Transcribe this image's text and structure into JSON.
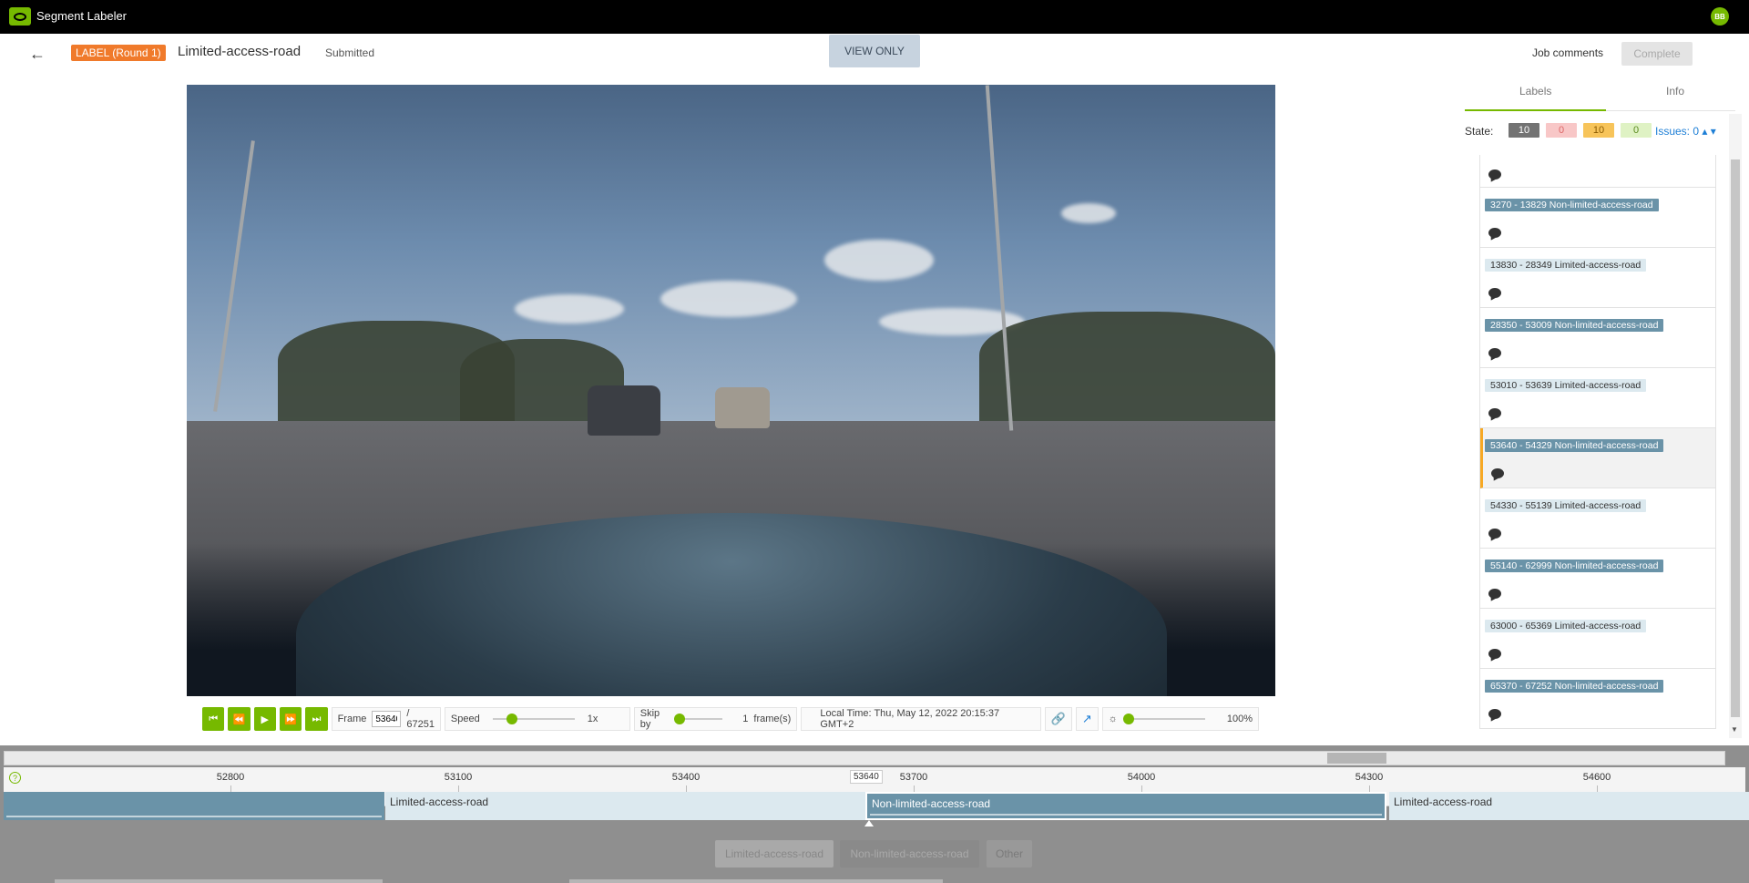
{
  "app": {
    "title": "Segment Labeler",
    "user_initials": "BB"
  },
  "header": {
    "badge": "LABEL (Round 1)",
    "title": "Limited-access-road",
    "status": "Submitted",
    "view_only": "VIEW ONLY",
    "job_comments": "Job comments",
    "complete": "Complete"
  },
  "player": {
    "frame_label": "Frame",
    "current_frame": "53640",
    "total_frames": "/ 67251",
    "speed_label": "Speed",
    "speed_value": "1x",
    "speed_level": 0.2,
    "skip_label": "Skip by",
    "skip_value": "1",
    "skip_unit": "frame(s)",
    "skip_level": 0.0,
    "local_time": "Local Time: Thu, May 12, 2022 20:15:37 GMT+2",
    "brightness_value": "100%",
    "brightness_level": 0.0
  },
  "panel": {
    "tabs": [
      "Labels",
      "Info"
    ],
    "active_tab": "Labels",
    "state_label": "State:",
    "state_counts": [
      {
        "value": "10",
        "bg": "#737373",
        "fg": "#ffffff"
      },
      {
        "value": "0",
        "bg": "#f8c7c7",
        "fg": "#d66"
      },
      {
        "value": "10",
        "bg": "#f7c45a",
        "fg": "#8a5a00"
      },
      {
        "value": "0",
        "bg": "#dff2c4",
        "fg": "#5a8a1e"
      }
    ],
    "issues": "Issues: 0",
    "segments": [
      {
        "label": "3270 - 13829 Non-limited-access-road",
        "style": "dark"
      },
      {
        "label": "13830 - 28349 Limited-access-road",
        "style": "light"
      },
      {
        "label": "28350 - 53009 Non-limited-access-road",
        "style": "dark"
      },
      {
        "label": "53010 - 53639 Limited-access-road",
        "style": "light"
      },
      {
        "label": "53640 - 54329 Non-limited-access-road",
        "style": "dark",
        "active": true
      },
      {
        "label": "54330 - 55139 Limited-access-road",
        "style": "light"
      },
      {
        "label": "55140 - 62999 Non-limited-access-road",
        "style": "dark"
      },
      {
        "label": "63000 - 65369 Limited-access-road",
        "style": "light"
      },
      {
        "label": "65370 - 67252 Non-limited-access-road",
        "style": "dark"
      }
    ]
  },
  "timeline": {
    "ticks": [
      "52800",
      "53100",
      "53400",
      "53700",
      "54000",
      "54300",
      "54600"
    ],
    "current_frame": "53640",
    "tracks": [
      {
        "label": "",
        "style": "dark"
      },
      {
        "label": "Limited-access-road",
        "style": "light"
      },
      {
        "label": "Non-limited-access-road",
        "style": "dark",
        "active": true
      },
      {
        "label": "Limited-access-road",
        "style": "light"
      }
    ],
    "class_buttons": [
      "Limited-access-road",
      "Non-limited-access-road",
      "Other"
    ]
  },
  "colors": {
    "accent": "#76b900",
    "badge": "#f07a2b",
    "active_marker": "#f7a823",
    "link": "#1e7fd6"
  }
}
